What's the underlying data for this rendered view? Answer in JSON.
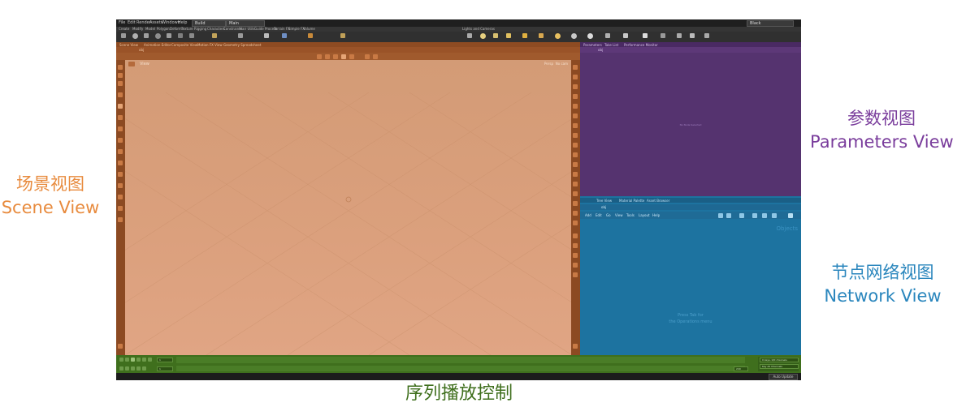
{
  "labels": {
    "scene": {
      "zh": "场景视图",
      "en": "Scene View"
    },
    "params": {
      "zh": "参数视图",
      "en": "Parameters View"
    },
    "network": {
      "zh": "节点网络视图",
      "en": "Network View"
    },
    "timeline": "序列播放控制"
  },
  "colors": {
    "scene": "#e88b3e",
    "params": "#7a3d9c",
    "network": "#2a86bd",
    "timeline": "#3f6f1d"
  },
  "app": {
    "menu": [
      "File",
      "Edit",
      "Render",
      "Assets",
      "Windows",
      "Help"
    ],
    "desktop": "Build",
    "desktop2": "Main",
    "user": "Black",
    "shelf_tabs": [
      "Create",
      "Modify",
      "Model",
      "Polygon",
      "Deform",
      "Texture",
      "Rigging",
      "Characters",
      "Constraints",
      "Hair Utils",
      "Guide Process",
      "Terrain FX",
      "Simple FX",
      "Volume"
    ],
    "light_tabs": [
      "Lights and Cameras"
    ]
  },
  "scene": {
    "tabs": [
      "Scene View",
      "Animation Editor",
      "Composite View",
      "Motion FX View",
      "Geometry Spreadsheet"
    ],
    "path": "obj",
    "viewport_label": "View",
    "persp": "Persp",
    "cam": "No cam"
  },
  "params": {
    "tabs": [
      "Parameters",
      "Take List",
      "Performance Monitor"
    ],
    "path": "obj",
    "empty": "No Node Selected"
  },
  "network": {
    "tabs": [
      "Tree View",
      "Material Palette",
      "Asset Browser"
    ],
    "path": "obj",
    "menu": [
      "Add",
      "Edit",
      "Go",
      "View",
      "Tools",
      "Layout",
      "Help"
    ],
    "objects_label": "Objects",
    "hint1": "Press Tab for",
    "hint2": "the Operations menu"
  },
  "timeline": {
    "start": "1",
    "end": "240",
    "current": "1",
    "keys": "0 keys, 0/0 channels",
    "key_all": "Key All Channels"
  },
  "status": {
    "update": "Auto Update"
  }
}
